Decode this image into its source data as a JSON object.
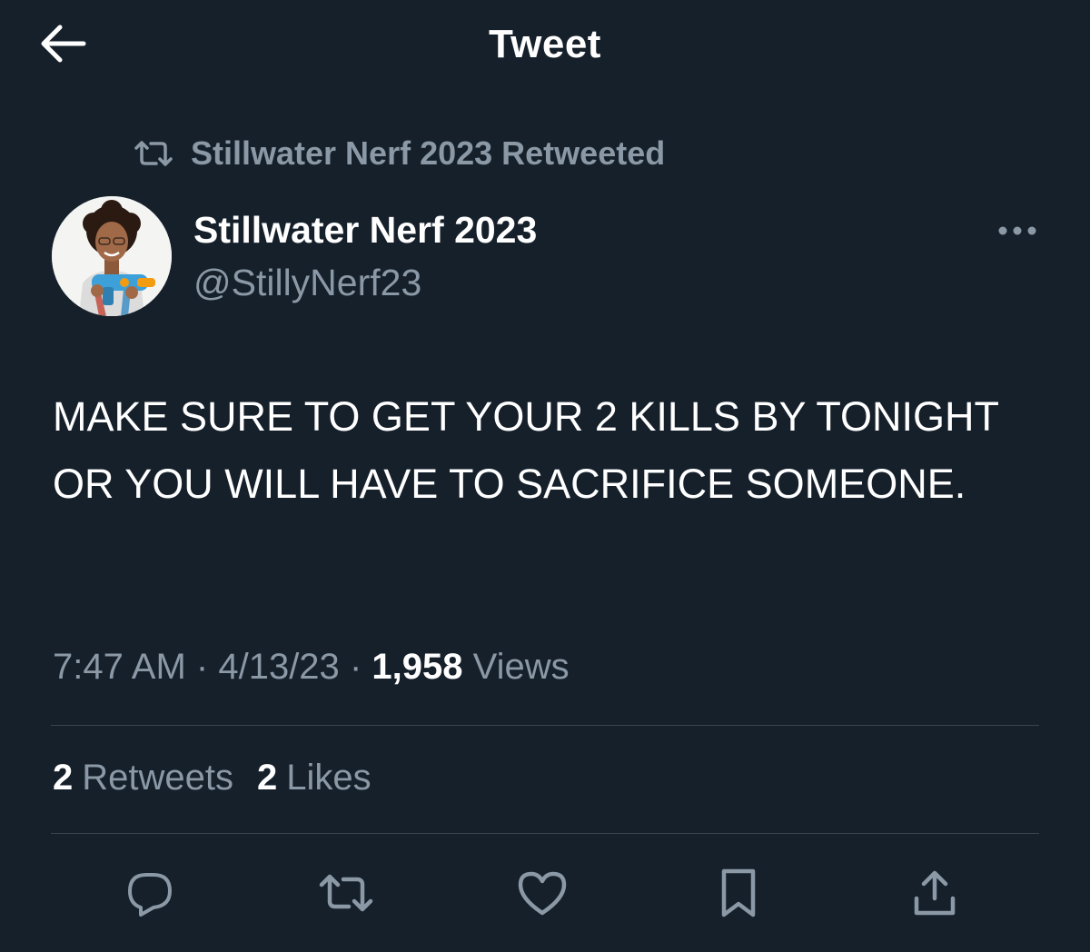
{
  "header": {
    "title": "Tweet"
  },
  "social_context": {
    "text": "Stillwater Nerf 2023 Retweeted"
  },
  "author": {
    "name": "Stillwater Nerf 2023",
    "handle": "@StillyNerf23"
  },
  "tweet": {
    "text": "MAKE SURE TO GET YOUR 2 KILLS BY TONIGHT OR YOU WILL HAVE TO SACRIFICE SOMEONE.",
    "time": "7:47 AM",
    "date": "4/13/23",
    "separator": "·",
    "views_count": "1,958",
    "views_label": "Views"
  },
  "stats": {
    "retweets_count": "2",
    "retweets_label": "Retweets",
    "likes_count": "2",
    "likes_label": "Likes"
  },
  "actions": [
    "reply-icon",
    "retweet-icon",
    "like-icon",
    "bookmark-icon",
    "share-icon"
  ],
  "colors": {
    "background": "#15202b",
    "text_primary": "#ffffff",
    "text_secondary": "#8b98a5",
    "divider": "#38444d"
  }
}
